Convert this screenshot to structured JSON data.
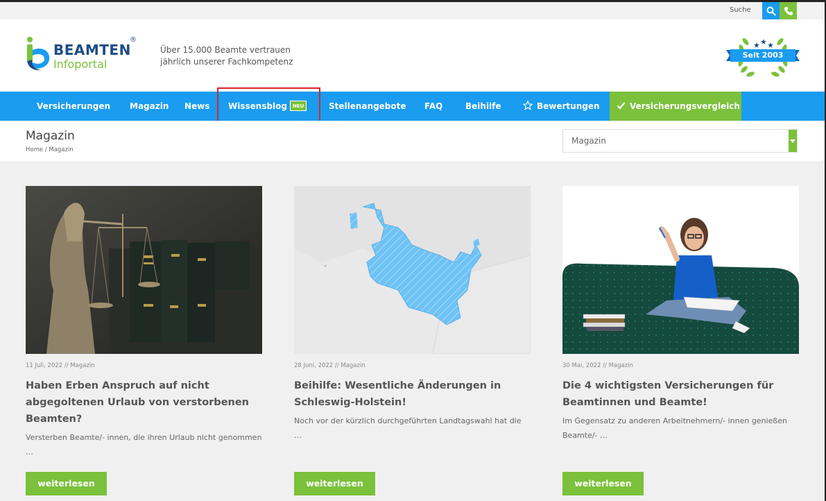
{
  "topbar": {
    "search_label": "Suche",
    "search_icon": "search-icon",
    "phone_icon": "phone-icon"
  },
  "header": {
    "logo_title": "BEAMTEN",
    "logo_subtitle": "Infoportal",
    "logo_registered": "®",
    "tagline_line1": "Über 15.000 Beamte vertrauen",
    "tagline_line2": "jährlich unserer Fachkompetenz",
    "badge_text": "Seit 2003"
  },
  "nav": {
    "items": [
      {
        "label": "Versicherungen"
      },
      {
        "label": "Magazin"
      },
      {
        "label": "News"
      },
      {
        "label": "Wissensblog",
        "badge": "NEU"
      },
      {
        "label": "Stellenangebote"
      },
      {
        "label": "FAQ"
      },
      {
        "label": "Beihilfe"
      },
      {
        "label": "Bewertungen",
        "icon": "star-outline-icon"
      }
    ],
    "cta": {
      "label": "Versicherungsvergleich",
      "icon": "checkmark-icon"
    }
  },
  "titlebar": {
    "title": "Magazin",
    "breadcrumb": "Home / Magazin",
    "select_value": "Magazin"
  },
  "cards": [
    {
      "meta": "11 Juli, 2022 // Magazin",
      "title": "Haben Erben Anspruch auf nicht abgegoltenen Urlaub von verstorbenen Beamten?",
      "excerpt": "Versterben Beamte/- innen, die ihren Urlaub nicht genommen …",
      "button": "weiterlesen"
    },
    {
      "meta": "28 Juni, 2022 // Magazin",
      "title": "Beihilfe: Wesentliche Änderungen in Schleswig-Holstein!",
      "excerpt": "Noch vor der kürzlich durchgeführten Landtagswahl hat die …",
      "button": "weiterlesen"
    },
    {
      "meta": "30 Mai, 2022 // Magazin",
      "title": "Die 4 wichtigsten Versicherungen für Beamtinnen und Beamte!",
      "excerpt": "Im Gegensatz zu anderen Arbeitnehmern/- innen genießen Beamte/- …",
      "button": "weiterlesen"
    }
  ],
  "colors": {
    "brand_blue": "#1a9cf0",
    "brand_green": "#7bc13b",
    "logo_navy": "#1e4c85",
    "highlight_red": "#d7262e"
  }
}
